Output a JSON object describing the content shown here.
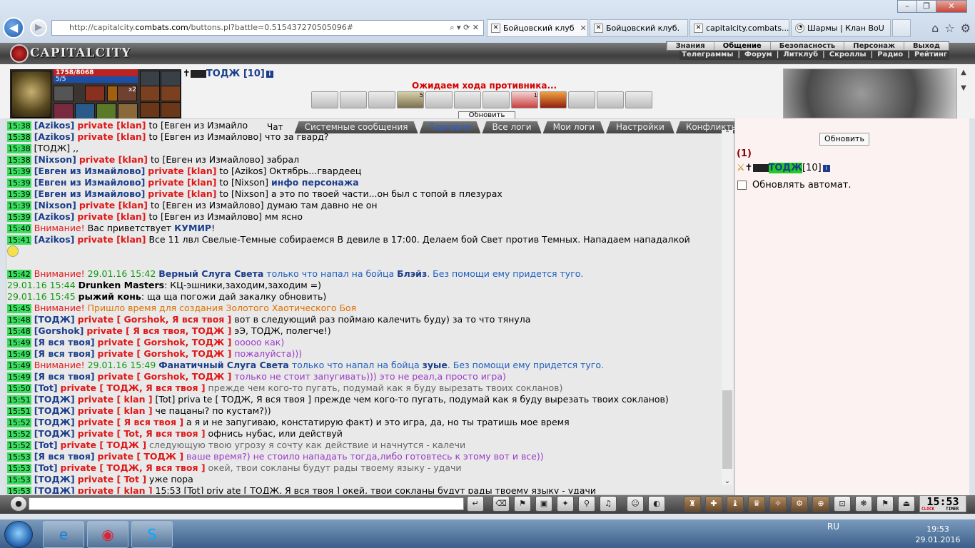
{
  "browser": {
    "url_prefix": "http://capitalcity.",
    "url_domain": "combats.com",
    "url_rest": "/buttons.pl?battle=0.515437270505096#",
    "tabs": [
      {
        "label": "Бойцовский клуб",
        "active": true
      },
      {
        "label": "Бойцовский клуб.",
        "active": false
      },
      {
        "label": "capitalcity.combats....",
        "active": false
      },
      {
        "label": "Шармы | Клан BoU",
        "active": false
      }
    ]
  },
  "game": {
    "logo": "CAPITALCITY",
    "menu_top": [
      "Знания",
      "Общение",
      "Безопасность",
      "Персонаж",
      "Выход"
    ],
    "menu_sub": [
      "Телеграммы",
      "|",
      "Форум",
      "|",
      "Литклуб",
      "|",
      "Скроллы",
      "|",
      "Радио",
      "|",
      "Рейтинг"
    ],
    "hp": "1758/8068",
    "mp": "5/5",
    "player": "ТОДЖ [10]",
    "status": "Ожидаем хода противника...",
    "refresh_top": "Обновить",
    "slot_badge": "x2",
    "scroll_badges": [
      "",
      "",
      "",
      "5",
      "",
      "",
      "",
      "1",
      "",
      "",
      "",
      ""
    ]
  },
  "chat_tabs": [
    "Чат",
    "Системные сообщения",
    "Торговля",
    "Все логи",
    "Мои логи",
    "Настройки",
    "Конфликты"
  ],
  "right": {
    "refresh": "Обновить",
    "count": "(1)",
    "user": "ТОДЖ",
    "user_level": "[10]",
    "auto_refresh": "Обновлять автомат."
  },
  "bottom": {
    "clock": "15:53",
    "clock_label": "CLOCK",
    "timer_label": "TIMER"
  },
  "taskbar": {
    "lang": "RU",
    "time": "19:53",
    "date": "29.01.2016"
  },
  "chat_lines": [
    [
      [
        "tm",
        "15:38"
      ],
      [
        "t",
        " "
      ],
      [
        "usr",
        "[Azikos]"
      ],
      [
        "t",
        " "
      ],
      [
        "prv",
        "private [klan]"
      ],
      [
        "t",
        " to [Евген из Измайлово] что за гвард?"
      ]
    ],
    [
      [
        "tm",
        "15:38"
      ],
      [
        "t",
        " [ТОДЖ] ,,"
      ]
    ],
    [
      [
        "tm",
        "15:38"
      ],
      [
        "t",
        " "
      ],
      [
        "usr",
        "[Nixson]"
      ],
      [
        "t",
        " "
      ],
      [
        "prv",
        "private [klan]"
      ],
      [
        "t",
        " to [Евген из Измайлово] забрал"
      ]
    ],
    [
      [
        "tm",
        "15:39"
      ],
      [
        "t",
        " "
      ],
      [
        "usr",
        "[Евген из Измайлово]"
      ],
      [
        "t",
        " "
      ],
      [
        "prv",
        "private [klan]"
      ],
      [
        "t",
        " to [Azikos] Октябрь...гвардеец"
      ]
    ],
    [
      [
        "tm",
        "15:39"
      ],
      [
        "t",
        " "
      ],
      [
        "usr",
        "[Евген из Измайлово]"
      ],
      [
        "t",
        " "
      ],
      [
        "prv",
        "private [klan]"
      ],
      [
        "t",
        " to [Nixson] "
      ],
      [
        "usr",
        "инфо персонажа"
      ]
    ],
    [
      [
        "tm",
        "15:39"
      ],
      [
        "t",
        " "
      ],
      [
        "usr",
        "[Евген из Измайлово]"
      ],
      [
        "t",
        " "
      ],
      [
        "prv",
        "private [klan]"
      ],
      [
        "t",
        " to [Nixson] а это по твоей части...он был с топой в плезурах"
      ]
    ],
    [
      [
        "tm",
        "15:39"
      ],
      [
        "t",
        " "
      ],
      [
        "usr",
        "[Nixson]"
      ],
      [
        "t",
        " "
      ],
      [
        "prv",
        "private [klan]"
      ],
      [
        "t",
        " to [Евген из Измайлово] думаю там давно не он"
      ]
    ],
    [
      [
        "tm",
        "15:39"
      ],
      [
        "t",
        " "
      ],
      [
        "usr",
        "[Azikos]"
      ],
      [
        "t",
        " "
      ],
      [
        "prv",
        "private [klan]"
      ],
      [
        "t",
        " to [Евген из Измайлово] мм ясно"
      ]
    ],
    [
      [
        "tm",
        "15:40"
      ],
      [
        "t",
        " "
      ],
      [
        "warn",
        "Внимание!"
      ],
      [
        "t",
        " Вас приветствует "
      ],
      [
        "usr",
        "КУМИР"
      ],
      [
        "t",
        "!"
      ]
    ],
    [
      [
        "tm",
        "15:41"
      ],
      [
        "t",
        " "
      ],
      [
        "usr",
        "[Azikos]"
      ],
      [
        "t",
        " "
      ],
      [
        "prv",
        "private [klan]"
      ],
      [
        "t",
        " Все 11 лвл Свелые-Темные собираемся В девиле в 17:00. Делаем бой Свет против Темных. Нападаем нападалкой"
      ]
    ],
    [
      [
        "smile",
        ""
      ]
    ],
    [
      [
        "t",
        ""
      ]
    ],
    [
      [
        "tm",
        "15:42"
      ],
      [
        "t",
        " "
      ],
      [
        "warn",
        "Внимание!"
      ],
      [
        "green",
        " 29.01.16 15:42 "
      ],
      [
        "usr",
        "Верный Слуга Света"
      ],
      [
        "blue",
        " только что напал на бойца "
      ],
      [
        "usr",
        "Блэйз"
      ],
      [
        "blue",
        ". Без помощи ему придется туго."
      ]
    ],
    [
      [
        "green",
        "29.01.16 15:44 "
      ],
      [
        "b",
        "Drunken Masters"
      ],
      [
        "t",
        ": КЦ-эшники,заходим,заходим =)"
      ]
    ],
    [
      [
        "green",
        "29.01.16 15:45 "
      ],
      [
        "b",
        "рыжий конь"
      ],
      [
        "t",
        ": ща ща погожи дай закалку обновить)"
      ]
    ],
    [
      [
        "tm",
        "15:45"
      ],
      [
        "t",
        " "
      ],
      [
        "warn",
        "Внимание!"
      ],
      [
        "orange",
        " Пришло время для создания Золотого Хаотического Боя"
      ]
    ],
    [
      [
        "tm",
        "15:48"
      ],
      [
        "t",
        " "
      ],
      [
        "usr",
        "[ТОДЖ]"
      ],
      [
        "t",
        " "
      ],
      [
        "prv",
        "private [ Gorshok, Я вся твоя ]"
      ],
      [
        "t",
        " вот в следующий раз поймаю калечить буду) за то что тянула"
      ]
    ],
    [
      [
        "tm",
        "15:48"
      ],
      [
        "t",
        " "
      ],
      [
        "usr",
        "[Gorshok]"
      ],
      [
        "t",
        " "
      ],
      [
        "prv",
        "private [ Я вся твоя, ТОДЖ ]"
      ],
      [
        "t",
        " эЭ, ТОДЖ, полегче!)"
      ]
    ],
    [
      [
        "tm",
        "15:49"
      ],
      [
        "t",
        " "
      ],
      [
        "usr",
        "[Я вся твоя]"
      ],
      [
        "t",
        " "
      ],
      [
        "prv",
        "private [ Gorshok, ТОДЖ ]"
      ],
      [
        "purple",
        " ооооо как)"
      ]
    ],
    [
      [
        "tm",
        "15:49"
      ],
      [
        "t",
        " "
      ],
      [
        "usr",
        "[Я вся твоя]"
      ],
      [
        "t",
        " "
      ],
      [
        "prv",
        "private [ Gorshok, ТОДЖ ]"
      ],
      [
        "purple",
        " пожалуйста)))"
      ]
    ],
    [
      [
        "tm",
        "15:49"
      ],
      [
        "t",
        " "
      ],
      [
        "warn",
        "Внимание!"
      ],
      [
        "green",
        " 29.01.16 15:49 "
      ],
      [
        "usr",
        "Фанатичный Слуга Света"
      ],
      [
        "blue",
        " только что напал на бойца "
      ],
      [
        "usr",
        "зуые"
      ],
      [
        "blue",
        ". Без помощи ему придется туго."
      ]
    ],
    [
      [
        "tm",
        "15:49"
      ],
      [
        "t",
        " "
      ],
      [
        "usr",
        "[Я вся твоя]"
      ],
      [
        "t",
        " "
      ],
      [
        "prv",
        "private [ Gorshok, ТОДЖ ]"
      ],
      [
        "purple",
        " только не стоит запугивать))) это не реал,а просто игра)"
      ]
    ],
    [
      [
        "tm",
        "15:50"
      ],
      [
        "t",
        " "
      ],
      [
        "usr",
        "[Tot]"
      ],
      [
        "t",
        " "
      ],
      [
        "prv",
        "private [ ТОДЖ, Я вся твоя ]"
      ],
      [
        "grey",
        " прежде чем кого-то пугать, подумай как я буду вырезать твоих сокланов)"
      ]
    ],
    [
      [
        "tm",
        "15:51"
      ],
      [
        "t",
        " "
      ],
      [
        "usr",
        "[ТОДЖ]"
      ],
      [
        "t",
        " "
      ],
      [
        "prv",
        "private [ klan ]"
      ],
      [
        "t",
        " [Tot] priva te [ ТОДЖ, Я вся твоя ] прежде чем кого-то пугать, подумай как я буду вырезать твоих сокланов)"
      ]
    ],
    [
      [
        "tm",
        "15:51"
      ],
      [
        "t",
        " "
      ],
      [
        "usr",
        "[ТОДЖ]"
      ],
      [
        "t",
        " "
      ],
      [
        "prv",
        "private [ klan ]"
      ],
      [
        "t",
        " че пацаны? по кустам?))"
      ]
    ],
    [
      [
        "tm",
        "15:52"
      ],
      [
        "t",
        " "
      ],
      [
        "usr",
        "[ТОДЖ]"
      ],
      [
        "t",
        " "
      ],
      [
        "prv",
        "private [ Я вся твоя ]"
      ],
      [
        "t",
        " а я и не запугиваю, констатирую факт) и это игра, да, но ты тратишь мое время"
      ]
    ],
    [
      [
        "tm",
        "15:52"
      ],
      [
        "t",
        " "
      ],
      [
        "usr",
        "[ТОДЖ]"
      ],
      [
        "t",
        " "
      ],
      [
        "prv",
        "private [ Tot, Я вся твоя ]"
      ],
      [
        "t",
        " офнись нубас, или действуй"
      ]
    ],
    [
      [
        "tm",
        "15:52"
      ],
      [
        "t",
        " "
      ],
      [
        "usr",
        "[Tot]"
      ],
      [
        "t",
        " "
      ],
      [
        "prv",
        "private [ ТОДЖ ]"
      ],
      [
        "grey",
        " следующую твою угрозу я сочту как действие и начнутся - калечи"
      ]
    ],
    [
      [
        "tm",
        "15:53"
      ],
      [
        "t",
        " "
      ],
      [
        "usr",
        "[Я вся твоя]"
      ],
      [
        "t",
        " "
      ],
      [
        "prv",
        "private [ ТОДЖ ]"
      ],
      [
        "purple",
        " ваше время?) не стоило нападать тогда,либо готовтесь к этому вот и все))"
      ]
    ],
    [
      [
        "tm",
        "15:53"
      ],
      [
        "t",
        " "
      ],
      [
        "usr",
        "[Tot]"
      ],
      [
        "t",
        " "
      ],
      [
        "prv",
        "private [ ТОДЖ, Я вся твоя ]"
      ],
      [
        "grey",
        " окей, твои сокланы будут рады твоему языку - удачи"
      ]
    ],
    [
      [
        "tm",
        "15:53"
      ],
      [
        "t",
        " "
      ],
      [
        "usr",
        "[ТОДЖ]"
      ],
      [
        "t",
        " "
      ],
      [
        "prv",
        "private [ Tot ]"
      ],
      [
        "t",
        " уже пора"
      ]
    ],
    [
      [
        "tm",
        "15:53"
      ],
      [
        "t",
        " "
      ],
      [
        "usr",
        "[ТОДЖ]"
      ],
      [
        "t",
        " "
      ],
      [
        "prv",
        "private [ klan ]"
      ],
      [
        "t",
        " 15:53 [Tot] priv ate [ ТОДЖ, Я вся твоя ] окей, твои сокланы будут рады твоему языку - удачи"
      ]
    ]
  ],
  "first_line": [
    [
      "tm",
      "15:38"
    ],
    [
      "t",
      " "
    ],
    [
      "usr",
      "[Azikos]"
    ],
    [
      "t",
      " "
    ],
    [
      "prv",
      "private [klan]"
    ],
    [
      "t",
      " to [Евген из Измайло"
    ]
  ]
}
